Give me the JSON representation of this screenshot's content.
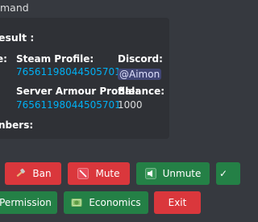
{
  "command_title": "mand",
  "embed": {
    "heading": "esult :",
    "fields": {
      "left_partial_label": "e:",
      "steam_profile_label": "Steam Profile:",
      "steam_profile_value": "76561198044505701",
      "discord_label": "Discord:",
      "discord_value": "@Aimon",
      "server_armour_label": "Server Armour Profile:",
      "server_armour_value": "76561198044505701",
      "balance_label": "Balance:",
      "balance_value": "1000",
      "members_partial_label": "nbers:"
    }
  },
  "buttons": {
    "row1": [
      {
        "label": "Ban",
        "icon": "hammer-icon",
        "style": "danger"
      },
      {
        "label": "Mute",
        "icon": "mute-icon",
        "style": "danger"
      },
      {
        "label": "Unmute",
        "icon": "speaker-icon",
        "style": "success"
      }
    ],
    "row2": [
      {
        "label": "Permission",
        "style": "success"
      },
      {
        "label": "Economics",
        "icon": "money-icon",
        "style": "success"
      },
      {
        "label": "Exit",
        "style": "danger"
      }
    ]
  },
  "colors": {
    "background": "#36393f",
    "embed_background": "#2f3136",
    "link": "#00b0f4",
    "danger": "#da373c",
    "success": "#248046",
    "mention_bg": "#414675"
  }
}
